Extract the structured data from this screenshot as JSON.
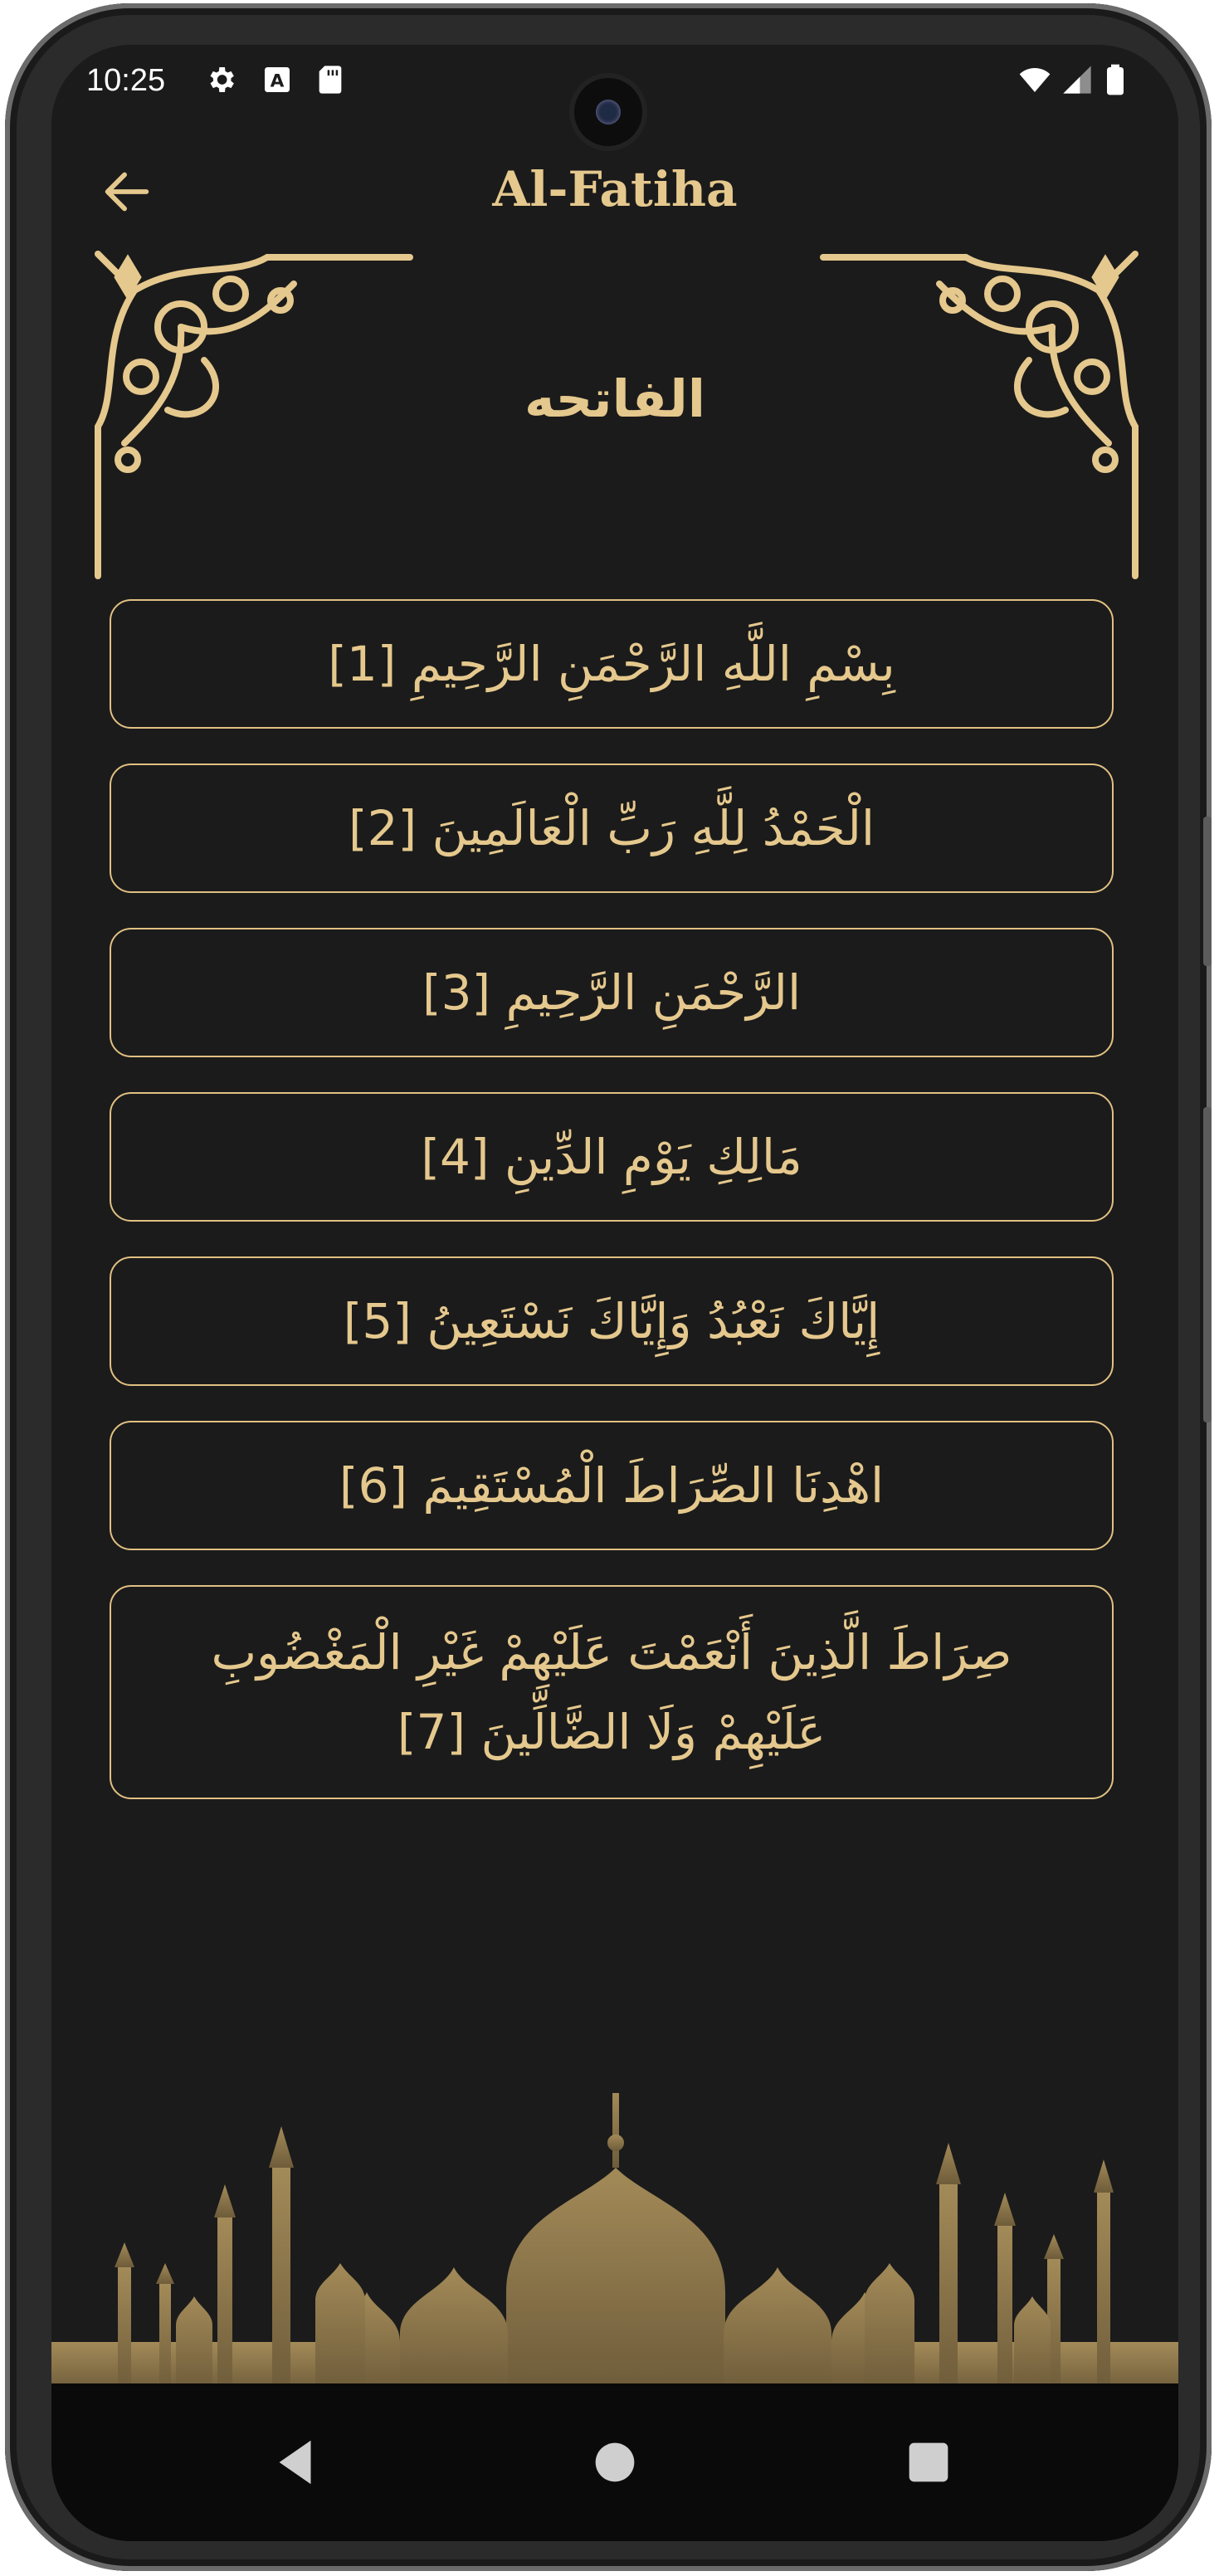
{
  "status_bar": {
    "time": "10:25",
    "icons": [
      "gear-icon",
      "a-icon",
      "sd-card-icon",
      "wifi-icon",
      "signal-icon",
      "battery-icon"
    ]
  },
  "app_bar": {
    "title": "Al-Fatiha",
    "back_icon": "arrow-left-icon"
  },
  "surah_arabic_title": "الفاتحه",
  "verses": [
    {
      "text": "بِسْمِ اللَّهِ الرَّحْمَنِ الرَّحِيمِ [1]"
    },
    {
      "text": "الْحَمْدُ لِلَّهِ رَبِّ الْعَالَمِينَ [2]"
    },
    {
      "text": "الرَّحْمَنِ الرَّحِيمِ  [3]"
    },
    {
      "text": "مَالِكِ يَوْمِ الدِّينِ  [4]"
    },
    {
      "text": "إِيَّاكَ نَعْبُدُ وَإِيَّاكَ نَسْتَعِينُ  [5]"
    },
    {
      "text": "اهْدِنَا الصِّرَاطَ الْمُسْتَقِيمَ  [6]"
    },
    {
      "text": "صِرَاطَ الَّذِينَ أَنْعَمْتَ عَلَيْهِمْ غَيْرِ الْمَغْضُوبِ عَلَيْهِمْ وَلَا الضَّالِّينَ  [7]"
    }
  ],
  "nav_bar": [
    "back-triangle-icon",
    "home-circle-icon",
    "recents-square-icon"
  ],
  "colors": {
    "background": "#1b1b1b",
    "gold": "#e5c88d",
    "gold_border": "#e1c082",
    "silhouette": "#a0895c"
  }
}
